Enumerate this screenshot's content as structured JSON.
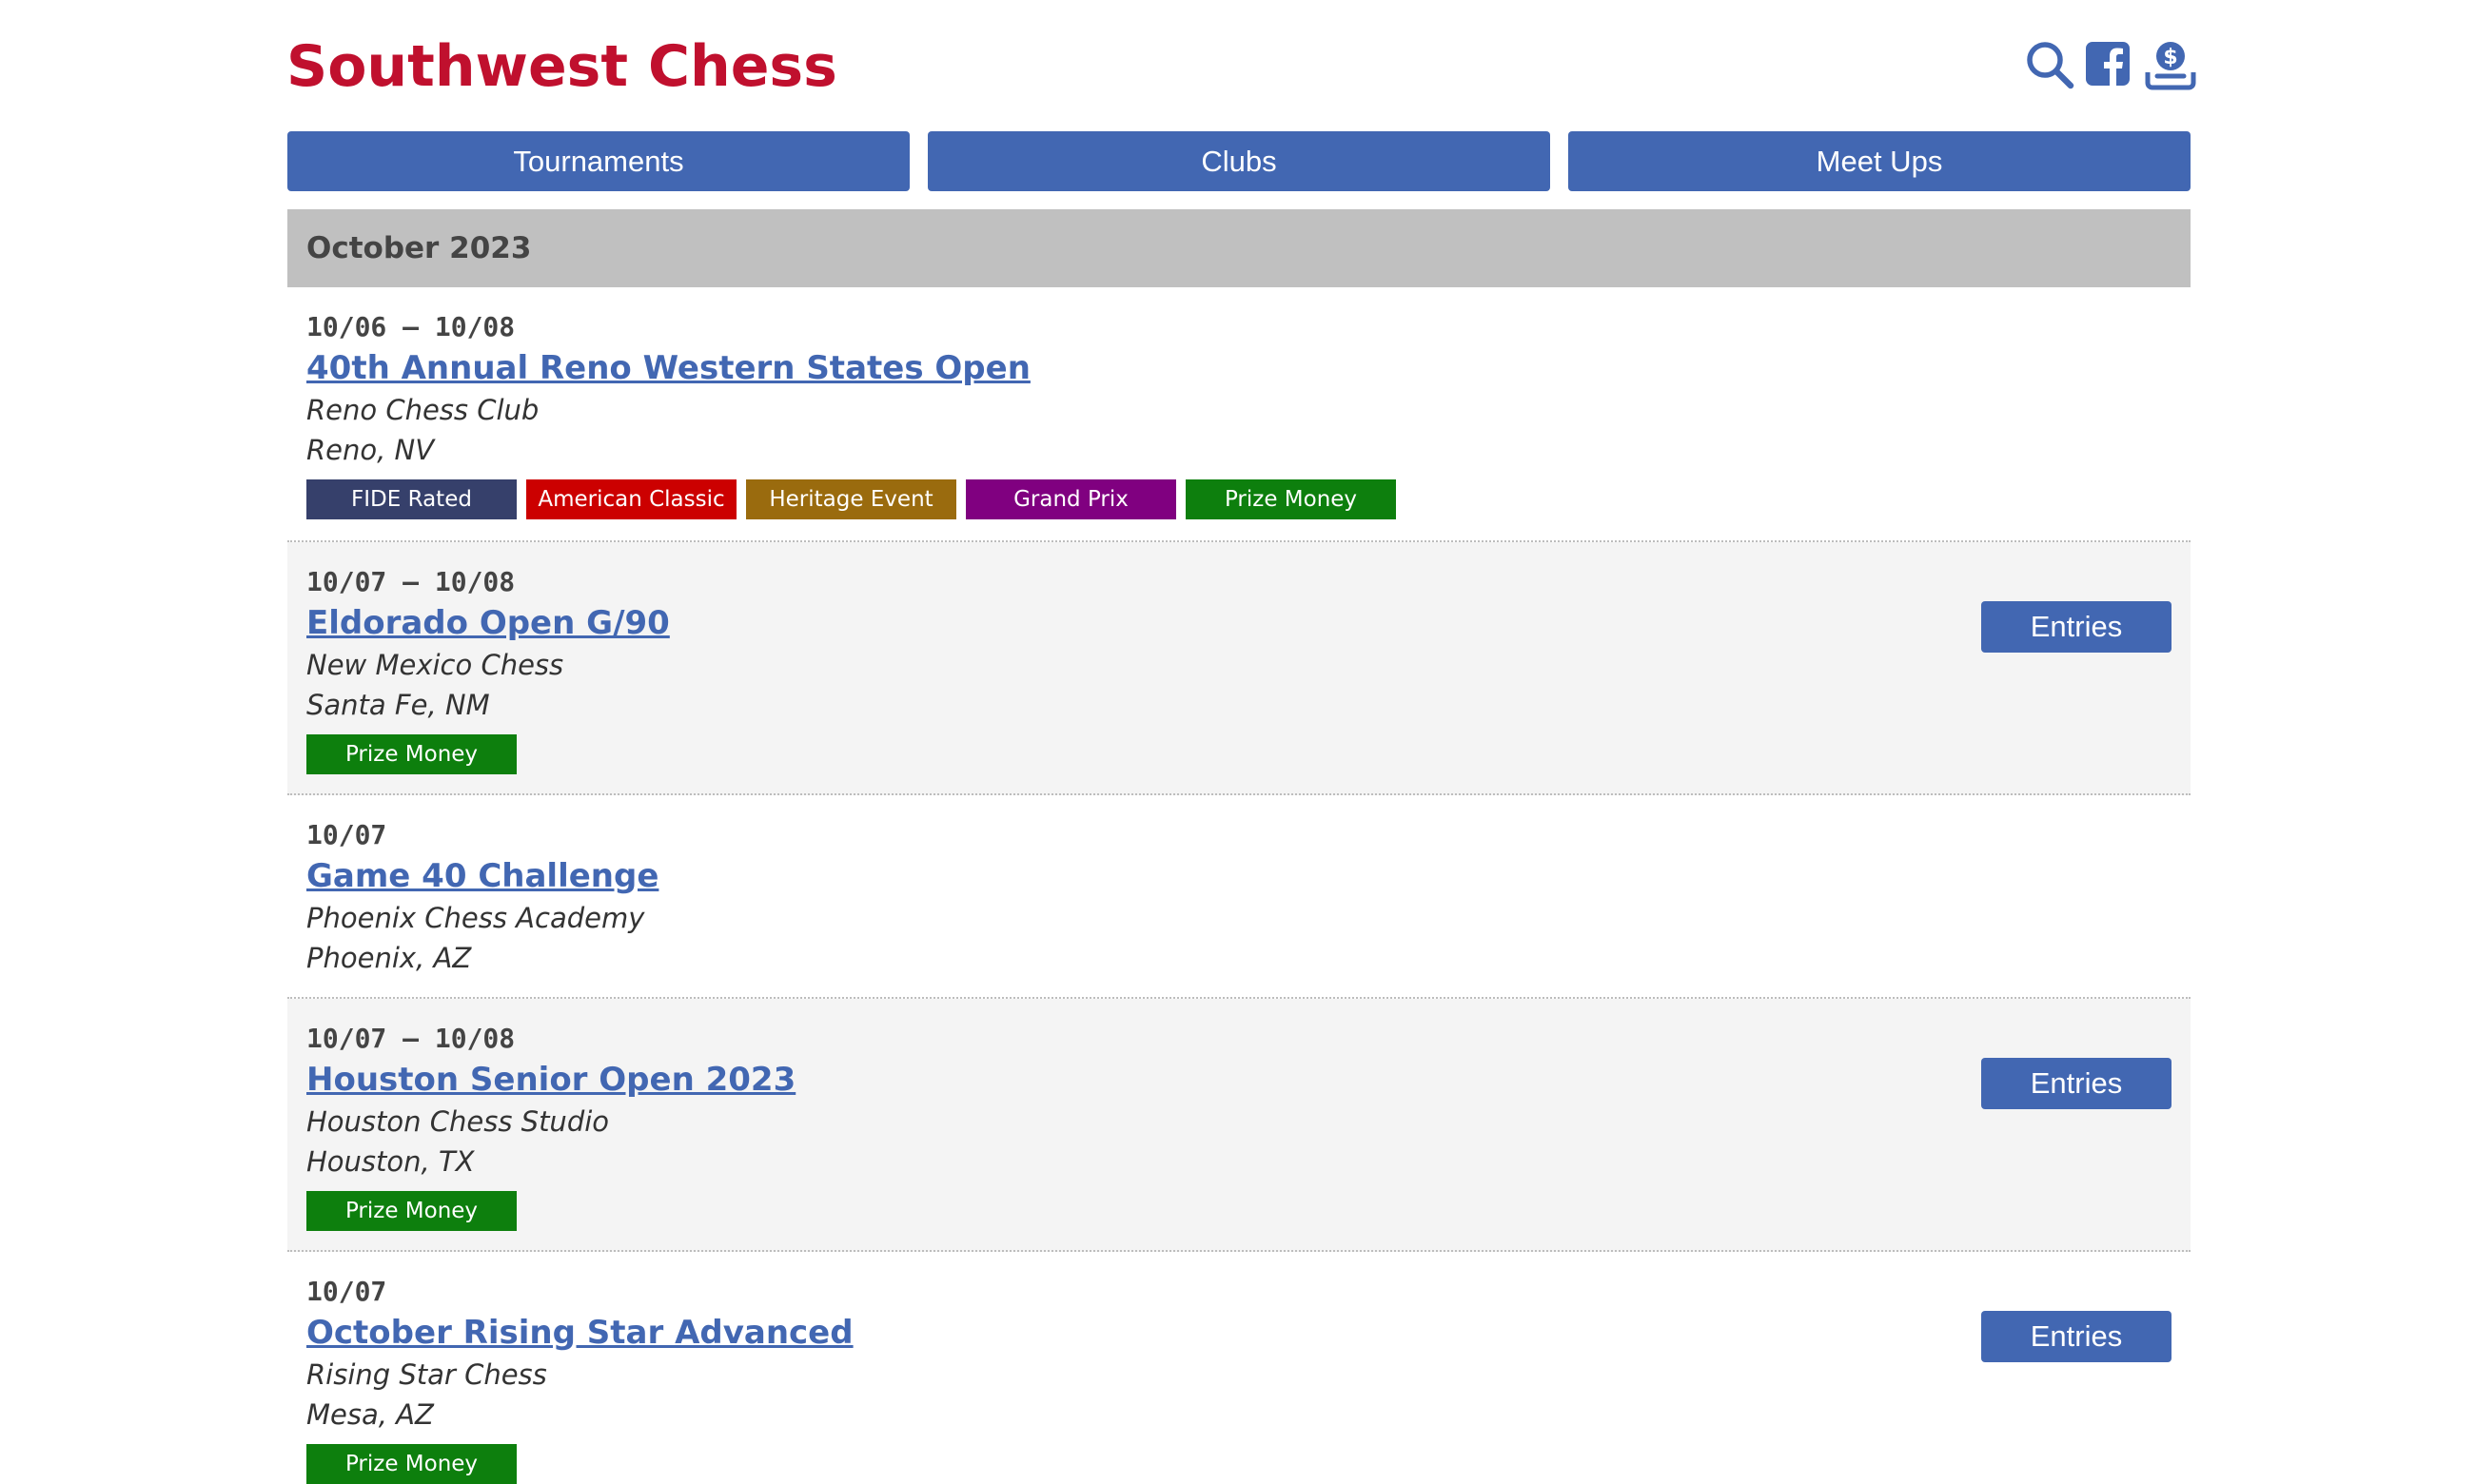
{
  "site": {
    "title": "Southwest Chess"
  },
  "header_icons": [
    "search-icon",
    "facebook-icon",
    "donate-icon"
  ],
  "nav": [
    {
      "label": "Tournaments"
    },
    {
      "label": "Clubs"
    },
    {
      "label": "Meet Ups"
    }
  ],
  "month": {
    "label": "October 2023"
  },
  "colors": {
    "brand_title": "#c0102e",
    "nav_button": "#4267b2",
    "link": "#4267b2",
    "tag_fide": "#36406b",
    "tag_american_classic": "#cc0000",
    "tag_heritage": "#9a6b0e",
    "tag_grand_prix": "#800080",
    "tag_prize": "#0d7f0d"
  },
  "events": [
    {
      "dates": "10/06 – 10/08",
      "title": "40th Annual Reno Western States Open",
      "org": "Reno Chess Club",
      "location": "Reno, NV",
      "tags": [
        {
          "label": "FIDE Rated",
          "color": "#36406b"
        },
        {
          "label": "American Classic",
          "color": "#cc0000"
        },
        {
          "label": "Heritage Event",
          "color": "#9a6b0e"
        },
        {
          "label": "Grand Prix",
          "color": "#800080"
        },
        {
          "label": "Prize Money",
          "color": "#0d7f0d"
        }
      ],
      "entries_label": ""
    },
    {
      "dates": "10/07 – 10/08",
      "title": "Eldorado Open G/90",
      "org": "New Mexico Chess",
      "location": "Santa Fe, NM",
      "tags": [
        {
          "label": "Prize Money",
          "color": "#0d7f0d"
        }
      ],
      "entries_label": "Entries"
    },
    {
      "dates": "10/07",
      "title": "Game 40 Challenge",
      "org": "Phoenix Chess Academy",
      "location": "Phoenix, AZ",
      "tags": [],
      "entries_label": ""
    },
    {
      "dates": "10/07 – 10/08",
      "title": "Houston Senior Open 2023",
      "org": "Houston Chess Studio",
      "location": "Houston, TX",
      "tags": [
        {
          "label": "Prize Money",
          "color": "#0d7f0d"
        }
      ],
      "entries_label": "Entries"
    },
    {
      "dates": "10/07",
      "title": "October Rising Star Advanced",
      "org": "Rising Star Chess",
      "location": "Mesa, AZ",
      "tags": [
        {
          "label": "Prize Money",
          "color": "#0d7f0d"
        }
      ],
      "entries_label": "Entries"
    }
  ]
}
